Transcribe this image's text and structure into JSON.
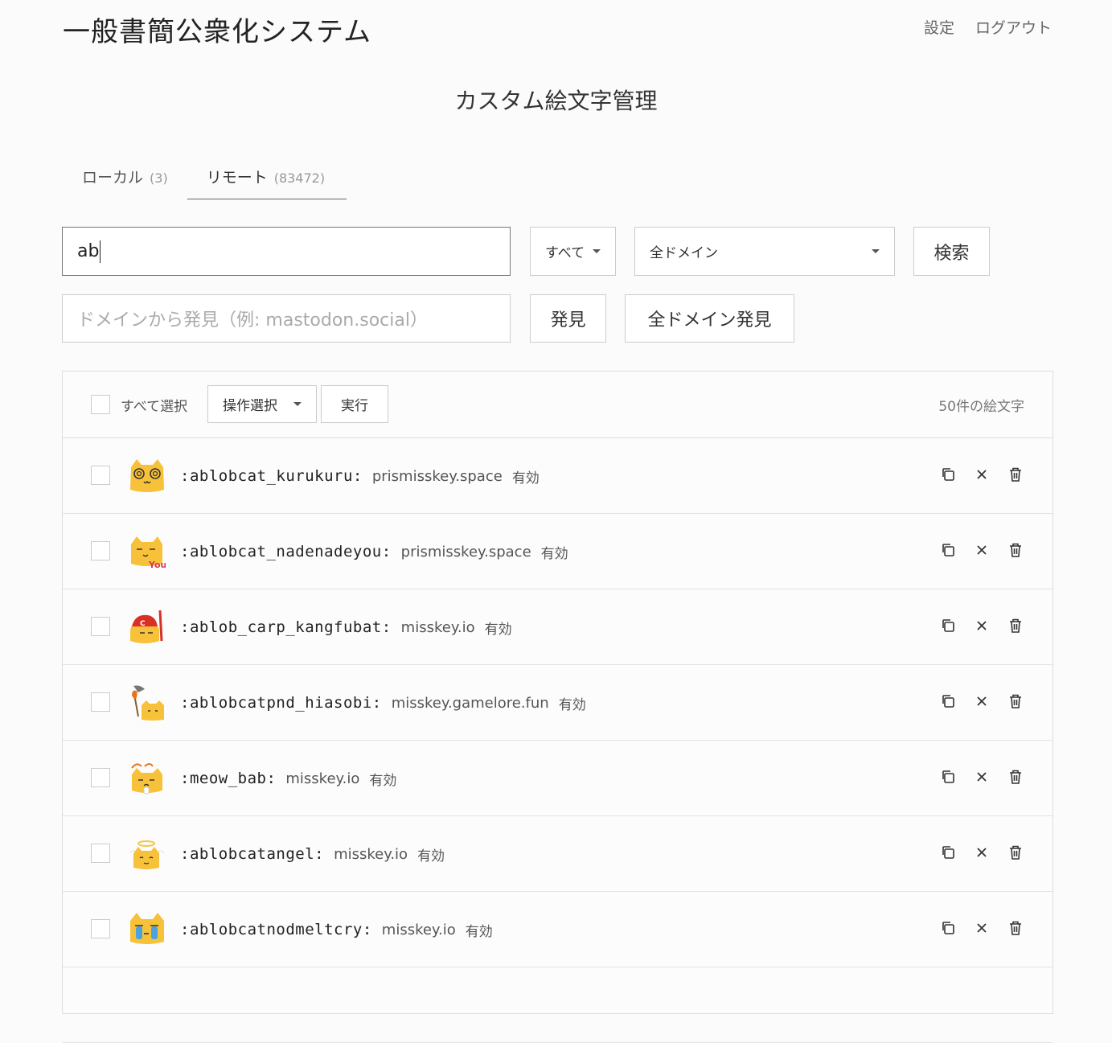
{
  "header": {
    "site_title": "一般書簡公衆化システム",
    "nav": {
      "settings": "設定",
      "logout": "ログアウト"
    }
  },
  "page_title": "カスタム絵文字管理",
  "tabs": [
    {
      "label": "ローカル",
      "count": "(3)"
    },
    {
      "label": "リモート",
      "count": "(83472)"
    }
  ],
  "search": {
    "value": "ab",
    "scope_select": "すべて",
    "domain_select": "全ドメイン",
    "search_button": "検索"
  },
  "discover": {
    "placeholder": "ドメインから発見（例: mastodon.social）",
    "discover_button": "発見",
    "discover_all_button": "全ドメイン発見"
  },
  "toolbar": {
    "select_all": "すべて選択",
    "operation_select": "操作選択",
    "execute": "実行",
    "count_label": "50件の絵文字"
  },
  "emojis": [
    {
      "shortcode": ":ablobcat_kurukuru:",
      "domain": "prismisskey.space",
      "status": "有効"
    },
    {
      "shortcode": ":ablobcat_nadenadeyou:",
      "domain": "prismisskey.space",
      "status": "有効"
    },
    {
      "shortcode": ":ablob_carp_kangfubat:",
      "domain": "misskey.io",
      "status": "有効"
    },
    {
      "shortcode": ":ablobcatpnd_hiasobi:",
      "domain": "misskey.gamelore.fun",
      "status": "有効"
    },
    {
      "shortcode": ":meow_bab:",
      "domain": "misskey.io",
      "status": "有効"
    },
    {
      "shortcode": ":ablobcatangel:",
      "domain": "misskey.io",
      "status": "有効"
    },
    {
      "shortcode": ":ablobcatnodmeltcry:",
      "domain": "misskey.io",
      "status": "有効"
    }
  ],
  "colors": {
    "emoji_yellow": "#f7c23a",
    "accent": "#666666"
  }
}
